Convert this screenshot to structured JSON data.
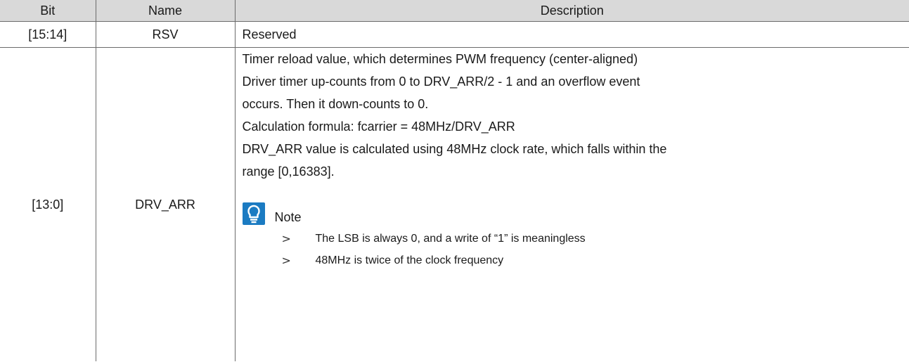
{
  "table": {
    "headers": {
      "bit": "Bit",
      "name": "Name",
      "description": "Description"
    },
    "rows": [
      {
        "bit": "[15:14]",
        "name": "RSV",
        "description": "Reserved"
      },
      {
        "bit": "[13:0]",
        "name": "DRV_ARR",
        "description_lines": [
          "Timer reload value, which determines PWM frequency (center-aligned)",
          "Driver timer up-counts from 0 to DRV_ARR/2 - 1 and an overflow event",
          "occurs. Then it down-counts to 0.",
          "Calculation formula: fcarrier = 48MHz/DRV_ARR",
          "DRV_ARR value is calculated using 48MHz clock rate, which falls within the",
          "range [0,16383]."
        ],
        "note": {
          "icon": "lightbulb-icon",
          "title": "Note",
          "items": [
            "The LSB is always 0, and a write of “1” is meaningless",
            "48MHz is twice of the clock frequency"
          ]
        }
      }
    ]
  },
  "colors": {
    "header_bg": "#d9d9d9",
    "note_icon_bg": "#1b7bc2"
  }
}
